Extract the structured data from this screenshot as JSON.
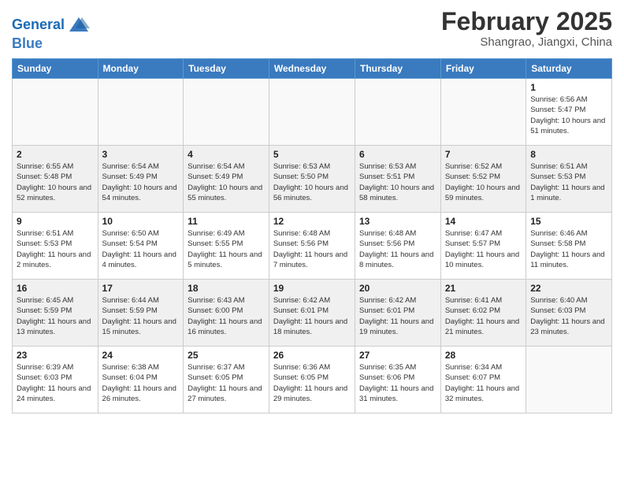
{
  "header": {
    "logo_line1": "General",
    "logo_line2": "Blue",
    "month_title": "February 2025",
    "location": "Shangrao, Jiangxi, China"
  },
  "columns": [
    "Sunday",
    "Monday",
    "Tuesday",
    "Wednesday",
    "Thursday",
    "Friday",
    "Saturday"
  ],
  "weeks": [
    {
      "bg": "light",
      "days": [
        {
          "date": "",
          "info": ""
        },
        {
          "date": "",
          "info": ""
        },
        {
          "date": "",
          "info": ""
        },
        {
          "date": "",
          "info": ""
        },
        {
          "date": "",
          "info": ""
        },
        {
          "date": "",
          "info": ""
        },
        {
          "date": "1",
          "info": "Sunrise: 6:56 AM\nSunset: 5:47 PM\nDaylight: 10 hours and 51 minutes."
        }
      ]
    },
    {
      "bg": "gray",
      "days": [
        {
          "date": "2",
          "info": "Sunrise: 6:55 AM\nSunset: 5:48 PM\nDaylight: 10 hours and 52 minutes."
        },
        {
          "date": "3",
          "info": "Sunrise: 6:54 AM\nSunset: 5:49 PM\nDaylight: 10 hours and 54 minutes."
        },
        {
          "date": "4",
          "info": "Sunrise: 6:54 AM\nSunset: 5:49 PM\nDaylight: 10 hours and 55 minutes."
        },
        {
          "date": "5",
          "info": "Sunrise: 6:53 AM\nSunset: 5:50 PM\nDaylight: 10 hours and 56 minutes."
        },
        {
          "date": "6",
          "info": "Sunrise: 6:53 AM\nSunset: 5:51 PM\nDaylight: 10 hours and 58 minutes."
        },
        {
          "date": "7",
          "info": "Sunrise: 6:52 AM\nSunset: 5:52 PM\nDaylight: 10 hours and 59 minutes."
        },
        {
          "date": "8",
          "info": "Sunrise: 6:51 AM\nSunset: 5:53 PM\nDaylight: 11 hours and 1 minute."
        }
      ]
    },
    {
      "bg": "light",
      "days": [
        {
          "date": "9",
          "info": "Sunrise: 6:51 AM\nSunset: 5:53 PM\nDaylight: 11 hours and 2 minutes."
        },
        {
          "date": "10",
          "info": "Sunrise: 6:50 AM\nSunset: 5:54 PM\nDaylight: 11 hours and 4 minutes."
        },
        {
          "date": "11",
          "info": "Sunrise: 6:49 AM\nSunset: 5:55 PM\nDaylight: 11 hours and 5 minutes."
        },
        {
          "date": "12",
          "info": "Sunrise: 6:48 AM\nSunset: 5:56 PM\nDaylight: 11 hours and 7 minutes."
        },
        {
          "date": "13",
          "info": "Sunrise: 6:48 AM\nSunset: 5:56 PM\nDaylight: 11 hours and 8 minutes."
        },
        {
          "date": "14",
          "info": "Sunrise: 6:47 AM\nSunset: 5:57 PM\nDaylight: 11 hours and 10 minutes."
        },
        {
          "date": "15",
          "info": "Sunrise: 6:46 AM\nSunset: 5:58 PM\nDaylight: 11 hours and 11 minutes."
        }
      ]
    },
    {
      "bg": "gray",
      "days": [
        {
          "date": "16",
          "info": "Sunrise: 6:45 AM\nSunset: 5:59 PM\nDaylight: 11 hours and 13 minutes."
        },
        {
          "date": "17",
          "info": "Sunrise: 6:44 AM\nSunset: 5:59 PM\nDaylight: 11 hours and 15 minutes."
        },
        {
          "date": "18",
          "info": "Sunrise: 6:43 AM\nSunset: 6:00 PM\nDaylight: 11 hours and 16 minutes."
        },
        {
          "date": "19",
          "info": "Sunrise: 6:42 AM\nSunset: 6:01 PM\nDaylight: 11 hours and 18 minutes."
        },
        {
          "date": "20",
          "info": "Sunrise: 6:42 AM\nSunset: 6:01 PM\nDaylight: 11 hours and 19 minutes."
        },
        {
          "date": "21",
          "info": "Sunrise: 6:41 AM\nSunset: 6:02 PM\nDaylight: 11 hours and 21 minutes."
        },
        {
          "date": "22",
          "info": "Sunrise: 6:40 AM\nSunset: 6:03 PM\nDaylight: 11 hours and 23 minutes."
        }
      ]
    },
    {
      "bg": "light",
      "days": [
        {
          "date": "23",
          "info": "Sunrise: 6:39 AM\nSunset: 6:03 PM\nDaylight: 11 hours and 24 minutes."
        },
        {
          "date": "24",
          "info": "Sunrise: 6:38 AM\nSunset: 6:04 PM\nDaylight: 11 hours and 26 minutes."
        },
        {
          "date": "25",
          "info": "Sunrise: 6:37 AM\nSunset: 6:05 PM\nDaylight: 11 hours and 27 minutes."
        },
        {
          "date": "26",
          "info": "Sunrise: 6:36 AM\nSunset: 6:05 PM\nDaylight: 11 hours and 29 minutes."
        },
        {
          "date": "27",
          "info": "Sunrise: 6:35 AM\nSunset: 6:06 PM\nDaylight: 11 hours and 31 minutes."
        },
        {
          "date": "28",
          "info": "Sunrise: 6:34 AM\nSunset: 6:07 PM\nDaylight: 11 hours and 32 minutes."
        },
        {
          "date": "",
          "info": ""
        }
      ]
    }
  ]
}
